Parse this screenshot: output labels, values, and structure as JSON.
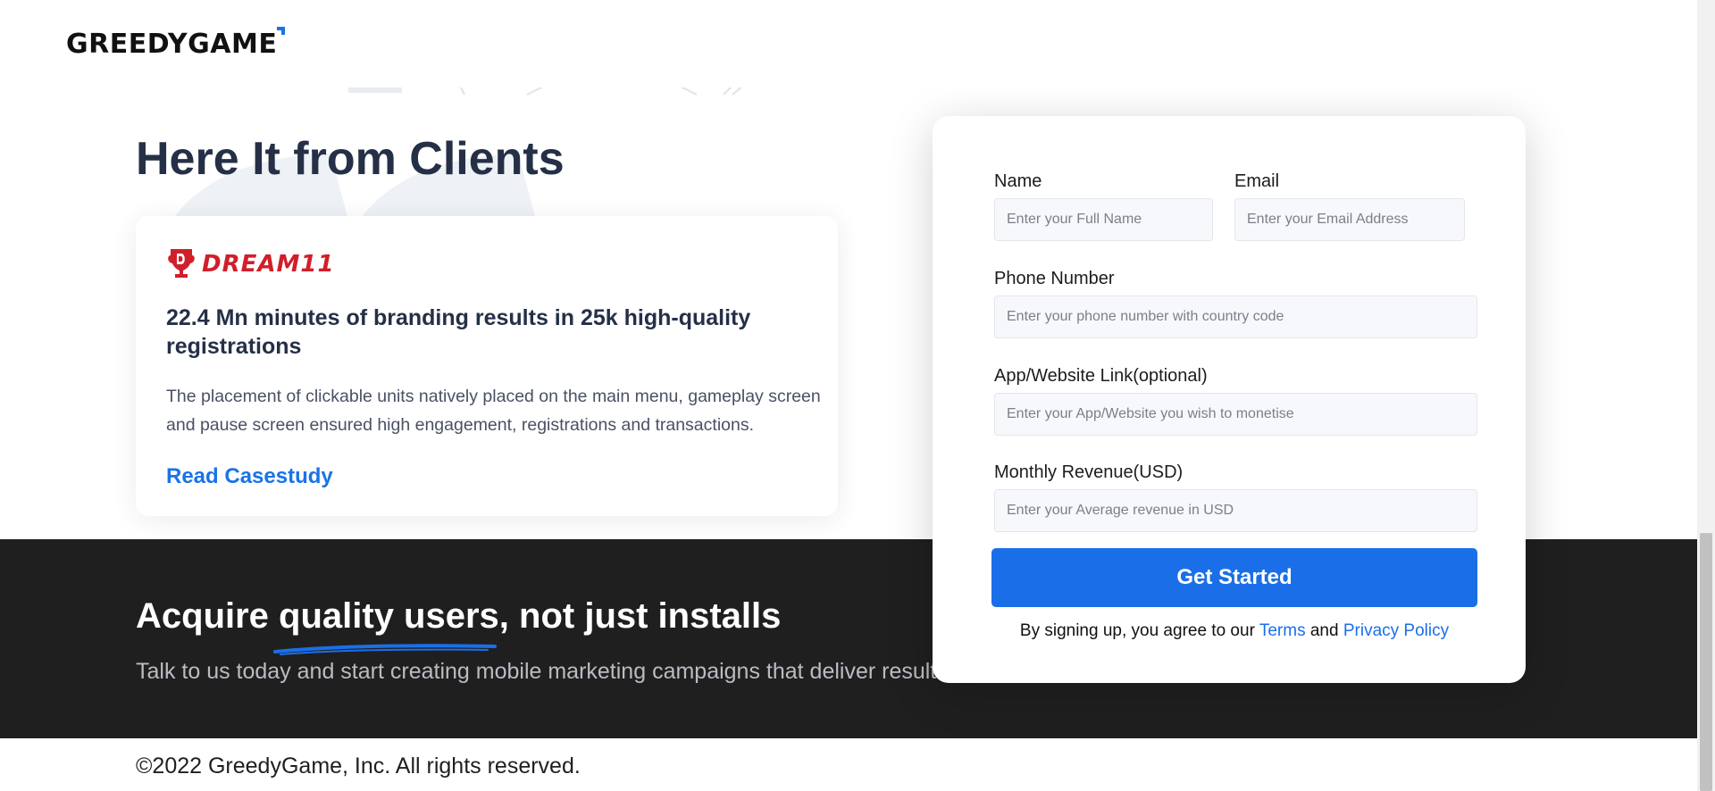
{
  "header": {
    "logo_text": "GREEDYGAME"
  },
  "clients": {
    "title": "Here It from Clients",
    "card": {
      "brand_logo_text": "DREAM11",
      "headline": "22.4 Mn minutes of branding results in 25k high-quality registrations",
      "body": "The placement of clickable units natively placed on the main menu, gameplay screen and pause screen ensured high engagement, registrations and transactions.",
      "link_label": "Read Casestudy"
    }
  },
  "cta": {
    "title": "Acquire quality users, not just installs",
    "subtitle": "Talk to us today and start creating mobile marketing campaigns that deliver results!"
  },
  "form": {
    "name_label": "Name",
    "name_placeholder": "Enter your Full Name",
    "email_label": "Email",
    "email_placeholder": "Enter your Email Address",
    "phone_label": "Phone Number",
    "phone_placeholder": "Enter your phone number with country code",
    "link_label": "App/Website Link(optional)",
    "link_placeholder": "Enter your App/Website you wish to monetise",
    "revenue_label": "Monthly Revenue(USD)",
    "revenue_placeholder": "Enter your Average revenue in USD",
    "submit_label": "Get Started",
    "agree_prefix": "By signing up, you agree to our",
    "terms_label": "Terms",
    "and_word": "and",
    "privacy_label": "Privacy Policy"
  },
  "footer": {
    "copyright": "©2022 GreedyGame, Inc. All rights reserved."
  },
  "colors": {
    "accent": "#1a6fe8",
    "dark_band": "#1f1f1f",
    "heading": "#253047",
    "brand_red": "#d11f2a"
  }
}
